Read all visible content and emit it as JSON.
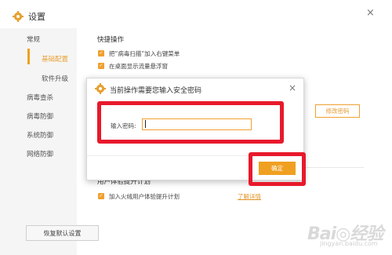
{
  "window": {
    "title": "设置",
    "close_symbol": "×",
    "icon": "gear-icon"
  },
  "sidebar": {
    "items": [
      {
        "label": "常规"
      },
      {
        "label": "基础配置",
        "active": true
      },
      {
        "label": "软件升级"
      },
      {
        "label": "病毒查杀"
      },
      {
        "label": "病毒防御"
      },
      {
        "label": "系统防御"
      },
      {
        "label": "网络防御"
      }
    ],
    "restore_label": "恢复默认设置"
  },
  "content": {
    "quick_ops_heading": "快捷操作",
    "option1": "把“病毒扫描”加入右键菜单",
    "option2": "在桌面显示流量悬浮窗",
    "change_password_label": "修改密码",
    "plan_heading": "用户体验提升计划",
    "plan_option": "加入火绒用户体验提升计划",
    "learn_more": "了解详情"
  },
  "dialog": {
    "title": "当前操作需要您输入安全密码",
    "close_symbol": "×",
    "password_label": "输入密码:",
    "password_value": "",
    "ok_label": "确定"
  },
  "watermark": {
    "brand": "Bai◎经验",
    "sub": "jingyan.baidu.com"
  },
  "colors": {
    "accent": "#f0a020",
    "highlight_red": "#e8192c"
  }
}
